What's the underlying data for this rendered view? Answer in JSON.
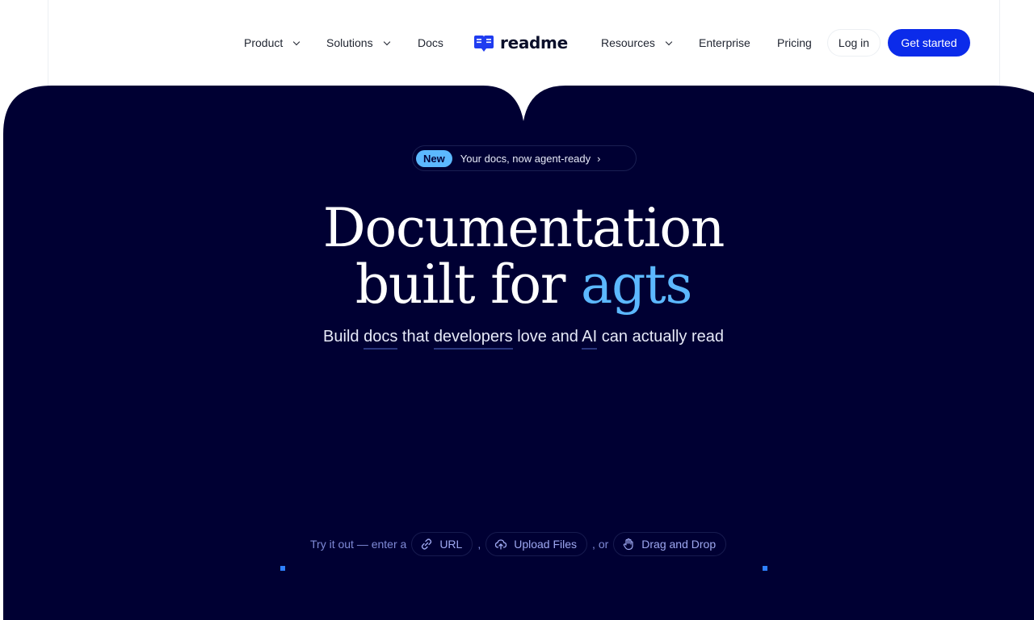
{
  "nav": {
    "product": "Product",
    "solutions": "Solutions",
    "docs": "Docs",
    "logo_text": "readme",
    "resources": "Resources",
    "enterprise": "Enterprise",
    "pricing": "Pricing",
    "login": "Log in",
    "get_started": "Get started"
  },
  "hero": {
    "badge": "New",
    "announcement": "Your docs, now agent-ready",
    "announcement_arrow": "›",
    "headline_line1": "Documentation",
    "headline_line2": "built for",
    "headline_accent": "agts",
    "sub_word1": "Build",
    "sub_word2": "docs",
    "sub_word3": "that",
    "sub_word4": "developers",
    "sub_word5": "love and",
    "sub_word6": "AI",
    "sub_word7": "can actually read",
    "try_prefix": "Try it out — enter a",
    "url_label": "URL",
    "sep1": ",",
    "upload_label": "Upload Files",
    "sep2": ", or",
    "drag_label": "Drag and Drop"
  },
  "colors": {
    "hero_bg": "#000033",
    "accent": "#5cb8ff",
    "cta": "#0b2bea"
  }
}
